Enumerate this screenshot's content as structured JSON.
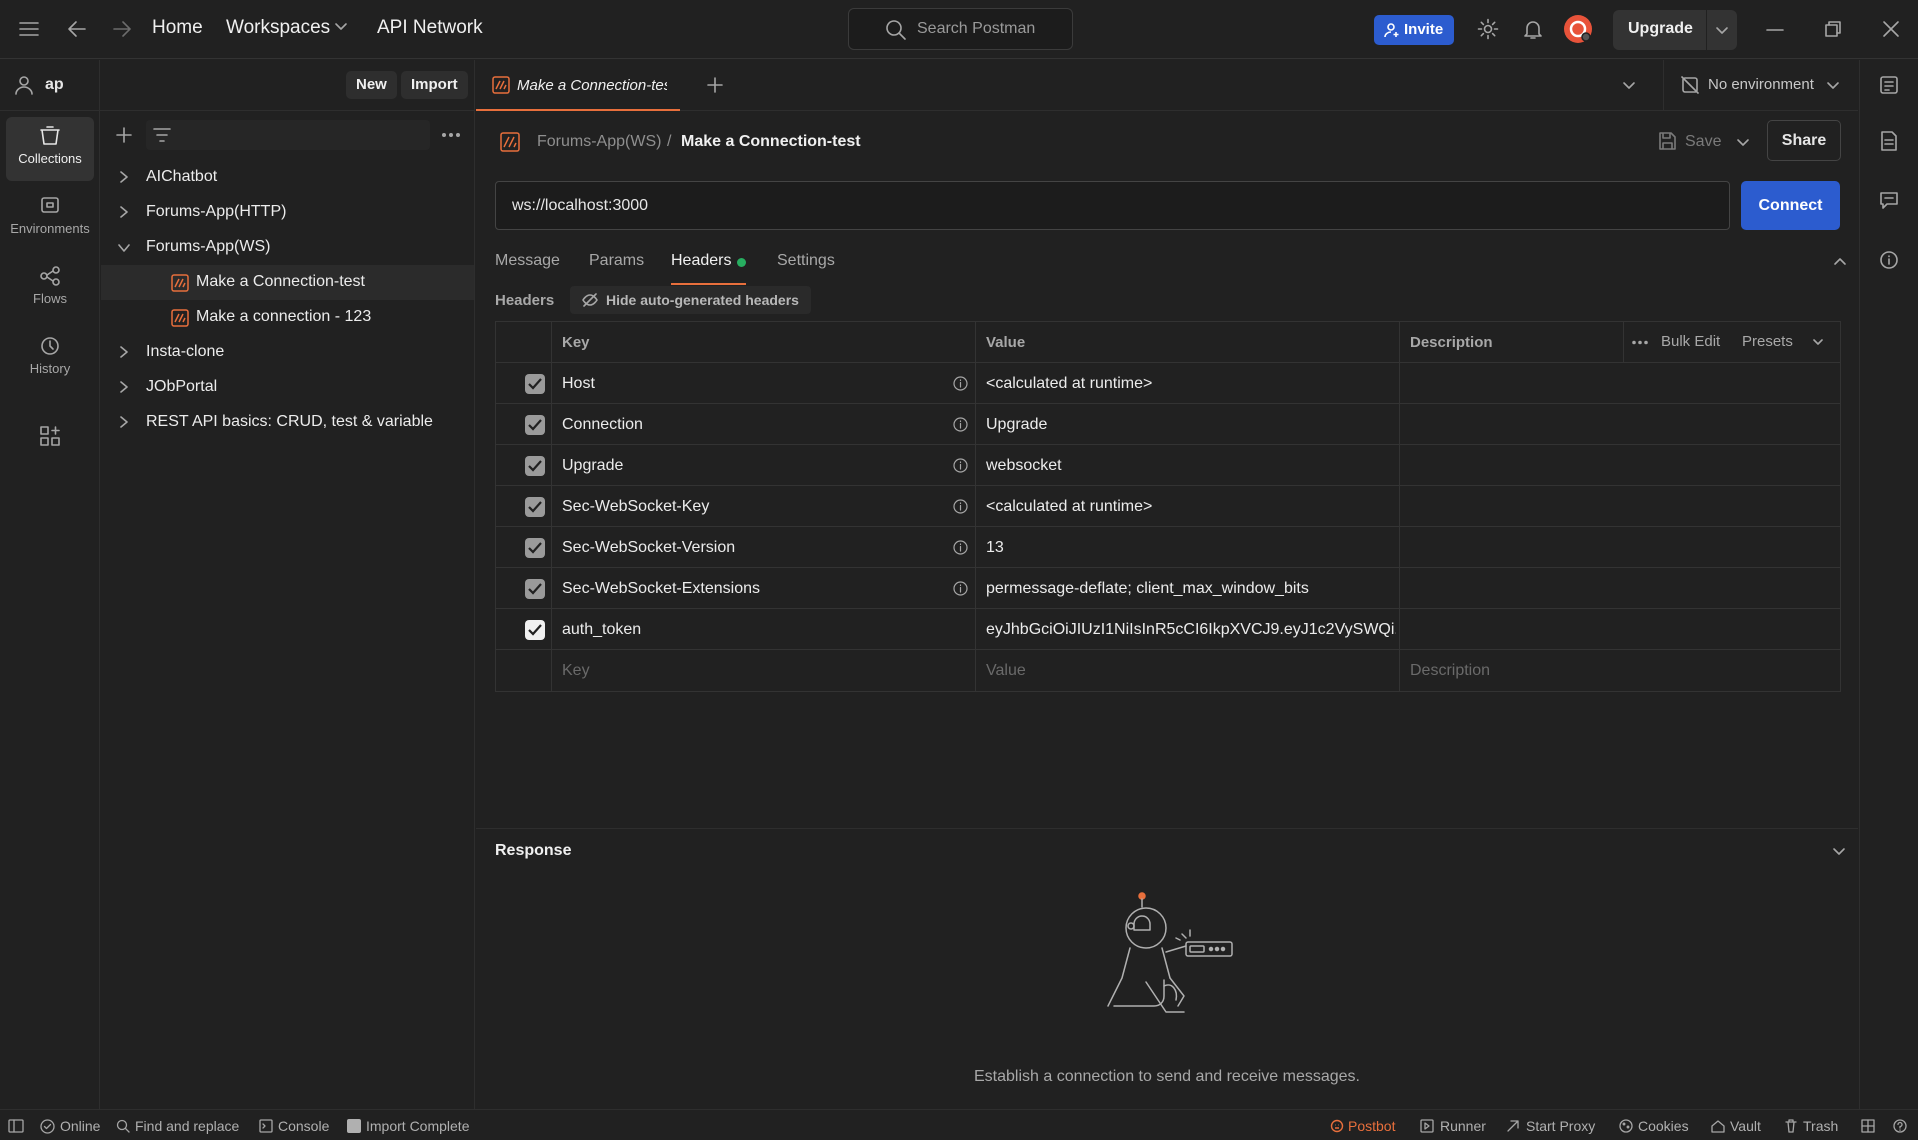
{
  "topbar": {
    "nav": [
      "Home",
      "Workspaces",
      "API Network"
    ],
    "search_placeholder": "Search Postman",
    "invite_label": "Invite",
    "upgrade_label": "Upgrade",
    "accent_color": "#2c5ccf"
  },
  "workspace": {
    "user": "ap",
    "new_label": "New",
    "import_label": "Import"
  },
  "rail": {
    "items": [
      "Collections",
      "Environments",
      "Flows",
      "History"
    ]
  },
  "collections": [
    {
      "label": "AIChatbot",
      "expanded": false
    },
    {
      "label": "Forums-App(HTTP)",
      "expanded": false
    },
    {
      "label": "Forums-App(WS)",
      "expanded": true,
      "children": [
        "Make a Connection-test",
        "Make a connection - 123"
      ]
    },
    {
      "label": "Insta-clone",
      "expanded": false
    },
    {
      "label": "JObPortal",
      "expanded": false
    },
    {
      "label": "REST API basics: CRUD, test & variable",
      "expanded": false
    }
  ],
  "tabs": {
    "active_tab": "Make a Connection-tes",
    "environment": "No environment"
  },
  "request": {
    "breadcrumb_parent": "Forums-App(WS)",
    "breadcrumb_sep": "/",
    "breadcrumb_current": "Make a Connection-test",
    "save_label": "Save",
    "share_label": "Share",
    "url": "ws://localhost:3000",
    "connect_label": "Connect",
    "tabs": [
      "Message",
      "Params",
      "Headers",
      "Settings"
    ],
    "active_tab": "Headers"
  },
  "headers": {
    "section_label": "Headers",
    "hide_auto_label": "Hide auto-generated headers",
    "columns": [
      "Key",
      "Value",
      "Description"
    ],
    "bulk_edit": "Bulk Edit",
    "presets": "Presets",
    "rows": [
      {
        "key": "Host",
        "value": "<calculated at runtime>",
        "auto": true
      },
      {
        "key": "Connection",
        "value": "Upgrade",
        "auto": true
      },
      {
        "key": "Upgrade",
        "value": "websocket",
        "auto": true
      },
      {
        "key": "Sec-WebSocket-Key",
        "value": "<calculated at runtime>",
        "auto": true
      },
      {
        "key": "Sec-WebSocket-Version",
        "value": "13",
        "auto": true
      },
      {
        "key": "Sec-WebSocket-Extensions",
        "value": "permessage-deflate; client_max_window_bits",
        "auto": true
      },
      {
        "key": "auth_token",
        "value": "eyJhbGciOiJIUzI1NiIsInR5cCI6IkpXVCJ9.eyJ1c2VySWQi...",
        "auto": false
      }
    ],
    "placeholder_key": "Key",
    "placeholder_value": "Value",
    "placeholder_desc": "Description"
  },
  "response": {
    "title": "Response",
    "empty_message": "Establish a connection to send and receive messages."
  },
  "statusbar": {
    "left": [
      "Online",
      "Find and replace",
      "Console",
      "Import Complete"
    ],
    "right": [
      "Postbot",
      "Runner",
      "Start Proxy",
      "Cookies",
      "Vault",
      "Trash"
    ]
  }
}
